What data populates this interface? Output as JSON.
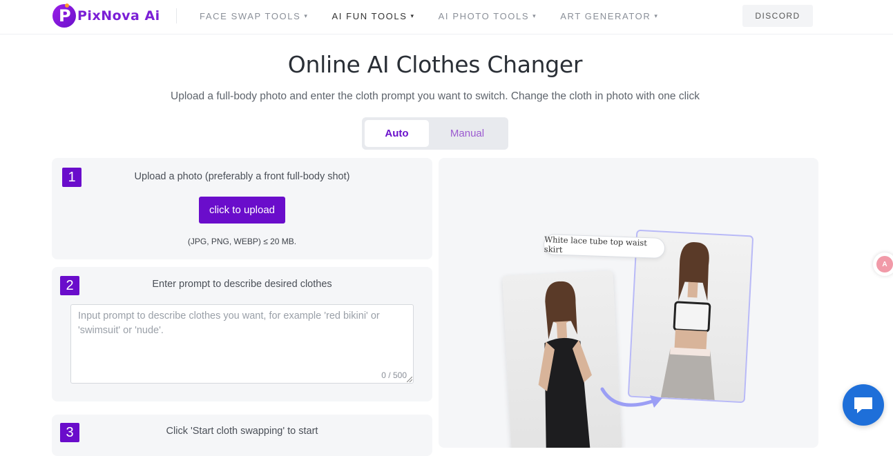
{
  "header": {
    "logo_text": "PixNova Ai",
    "nav": [
      {
        "label": "FACE SWAP TOOLS"
      },
      {
        "label": "AI FUN TOOLS"
      },
      {
        "label": "AI PHOTO TOOLS"
      },
      {
        "label": "ART GENERATOR"
      }
    ],
    "discord_label": "DISCORD"
  },
  "hero": {
    "title": "Online AI Clothes Changer",
    "subtitle": "Upload a full-body photo and enter the cloth prompt you want to switch. Change the cloth in photo with one click"
  },
  "mode_tabs": {
    "auto": "Auto",
    "manual": "Manual",
    "selected": "Auto"
  },
  "steps": [
    {
      "number": "1",
      "text": "Upload a photo (preferably a front full-body shot)",
      "button": "click to upload",
      "formats": "(JPG, PNG, WEBP) ≤ 20 MB."
    },
    {
      "number": "2",
      "text": "Enter prompt to describe desired clothes",
      "placeholder": "Input prompt to describe clothes you want, for example 'red bikini' or 'swimsuit' or 'nude'.",
      "char_count": "0 / 500"
    },
    {
      "number": "3",
      "text": "Click 'Start cloth swapping' to start"
    }
  ],
  "preview": {
    "tag": "White lace tube top waist skirt"
  },
  "colors": {
    "brand_purple": "#6a0dcb",
    "chat_blue": "#1e6fd9"
  }
}
